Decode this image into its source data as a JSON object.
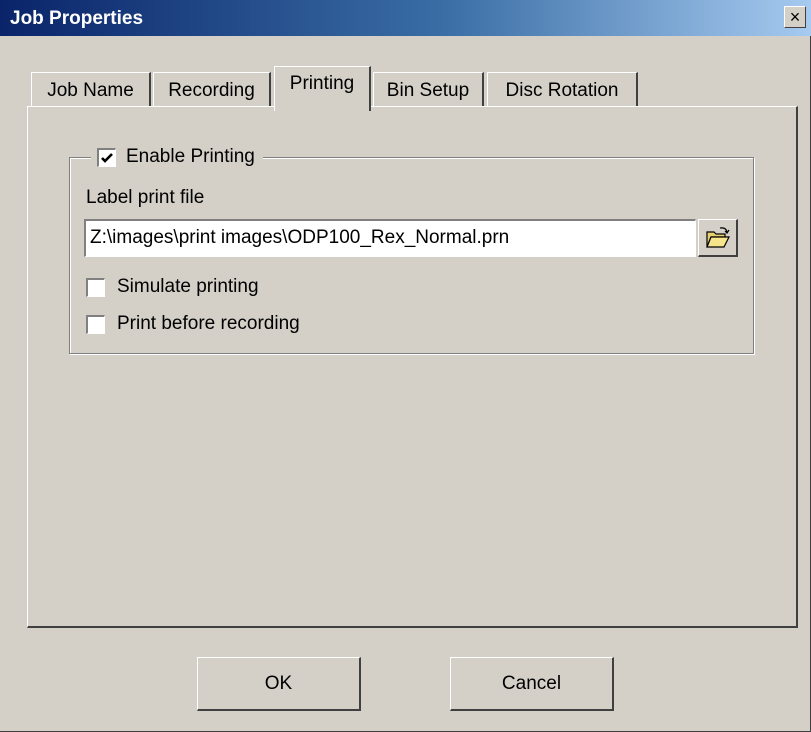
{
  "window": {
    "title": "Job Properties",
    "close_symbol": "×"
  },
  "tabs": [
    {
      "label": "Job Name"
    },
    {
      "label": "Recording"
    },
    {
      "label": "Printing",
      "active": true
    },
    {
      "label": "Bin Setup"
    },
    {
      "label": "Disc Rotation"
    }
  ],
  "printing": {
    "enable_printing": {
      "label": "Enable Printing",
      "checked": true
    },
    "label_print_file": {
      "label": "Label print file",
      "value": "Z:\\images\\print images\\ODP100_Rex_Normal.prn",
      "browse_icon": "folder-open-icon"
    },
    "simulate_printing": {
      "label": "Simulate printing",
      "checked": false
    },
    "print_before_recording": {
      "label": "Print before recording",
      "checked": false
    }
  },
  "buttons": {
    "ok": "OK",
    "cancel": "Cancel"
  }
}
